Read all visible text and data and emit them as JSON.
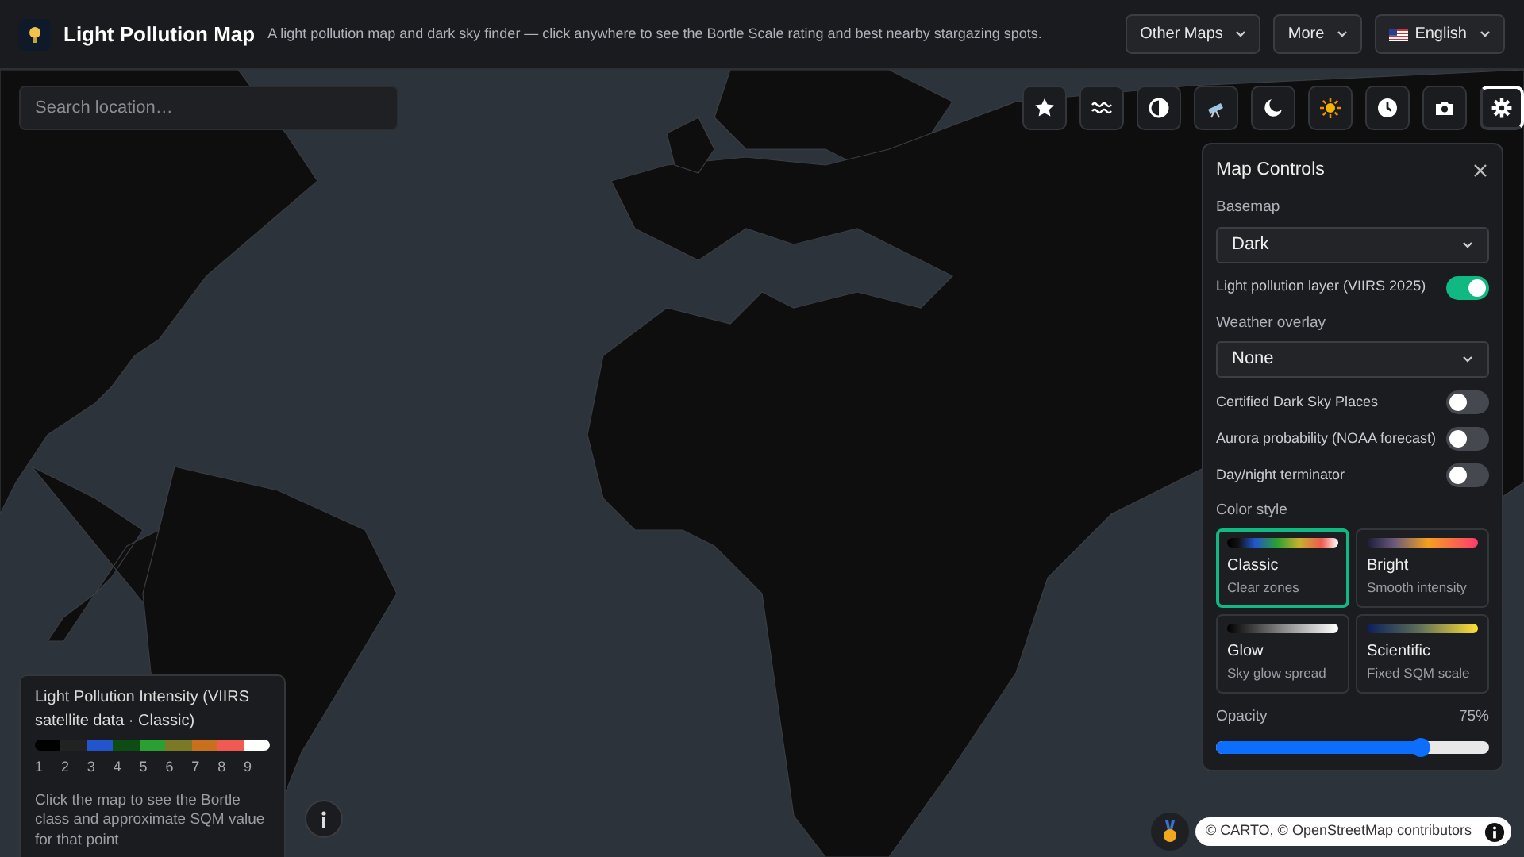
{
  "header": {
    "title": "Light Pollution Map",
    "subtitle": "A light pollution map and dark sky finder — click anywhere to see the Bortle Scale rating and best nearby stargazing spots.",
    "menus": [
      {
        "label": "Other Maps",
        "kind": "plain"
      },
      {
        "label": "More",
        "kind": "plain"
      },
      {
        "label": "English",
        "kind": "flag"
      }
    ]
  },
  "search": {
    "placeholder": "Search location…"
  },
  "toolbar": [
    {
      "kind": "star",
      "selected": false
    },
    {
      "kind": "waves",
      "selected": false
    },
    {
      "kind": "contrast",
      "selected": false
    },
    {
      "kind": "telescope",
      "selected": false
    },
    {
      "kind": "moon",
      "selected": false
    },
    {
      "kind": "sun",
      "selected": false
    },
    {
      "kind": "clock",
      "selected": false
    },
    {
      "kind": "camera",
      "selected": false
    },
    {
      "kind": "gear",
      "selected": true
    }
  ],
  "panel": {
    "title": "Map Controls",
    "basemap": {
      "label": "Basemap",
      "value": "Dark"
    },
    "layer_toggle": {
      "label": "Light pollution layer (VIIRS 2025)",
      "on": true
    },
    "weather": {
      "label": "Weather overlay",
      "value": "None"
    },
    "toggles": [
      {
        "label": "Certified Dark Sky Places",
        "on": false
      },
      {
        "label": "Aurora probability (NOAA forecast)",
        "on": false
      },
      {
        "label": "Day/night terminator",
        "on": false
      }
    ],
    "color_style_label": "Color style",
    "styles": [
      {
        "kind": "classic",
        "name": "Classic",
        "description": "Clear zones",
        "selected": true
      },
      {
        "kind": "bright",
        "name": "Bright",
        "description": "Smooth intensity",
        "selected": false
      },
      {
        "kind": "glow",
        "name": "Glow",
        "description": "Sky glow spread",
        "selected": false
      },
      {
        "kind": "scientific",
        "name": "Scientific",
        "description": "Fixed SQM scale",
        "selected": false
      }
    ],
    "opacity": {
      "label": "Opacity",
      "reading": "75%",
      "level": 0.75
    }
  },
  "legend": {
    "title": "Light Pollution Intensity (VIIRS satellite data · Classic)",
    "scale": [
      {
        "label": "1",
        "color": "#000000"
      },
      {
        "label": "2",
        "color": "#222222"
      },
      {
        "label": "3",
        "color": "#2255cc"
      },
      {
        "label": "4",
        "color": "#0d4d14"
      },
      {
        "label": "5",
        "color": "#2aa032"
      },
      {
        "label": "6",
        "color": "#7a7a26"
      },
      {
        "label": "7",
        "color": "#c8701e"
      },
      {
        "label": "8",
        "color": "#f05a50"
      },
      {
        "label": "9",
        "color": "#ffffff"
      }
    ],
    "note": "Click the map to see the Bortle class and approximate SQM value for that point"
  },
  "attribution": "© CARTO, © OpenStreetMap contributors"
}
